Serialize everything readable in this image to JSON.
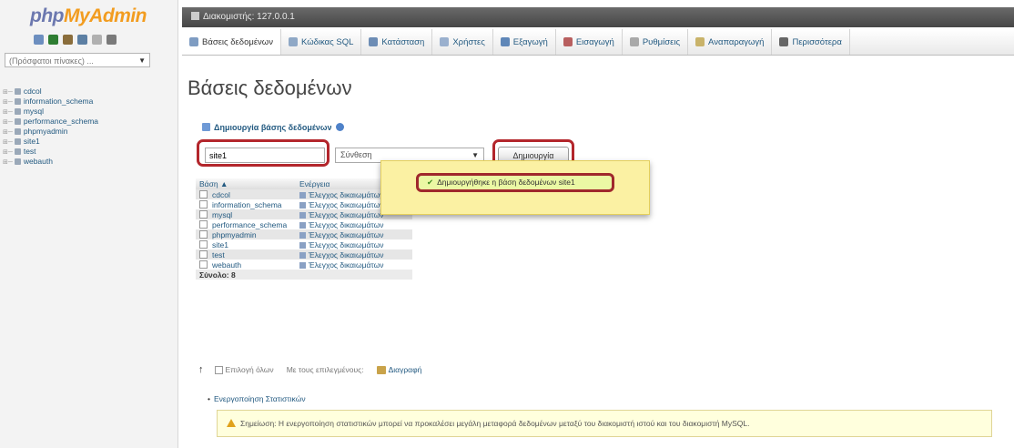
{
  "app": {
    "logo_php": "php",
    "logo_myadmin": "MyAdmin"
  },
  "nav": {
    "recent_placeholder": "(Πρόσφατοι πίνακες) ...",
    "databases": [
      "cdcol",
      "information_schema",
      "mysql",
      "performance_schema",
      "phpmyadmin",
      "site1",
      "test",
      "webauth"
    ],
    "icon_colors": [
      "#6c8ebf",
      "#2e7d32",
      "#8a6d3b",
      "#5c7fa3",
      "#b0b0b0",
      "#7a7a7a"
    ]
  },
  "serverbar": {
    "label": "Διακομιστής: 127.0.0.1"
  },
  "tabs": [
    {
      "label": "Βάσεις δεδομένων",
      "icon": "database-icon",
      "color": "#7e9cc2",
      "active": true
    },
    {
      "label": "Κώδικας SQL",
      "icon": "sql-icon",
      "color": "#8fa8c6",
      "active": false
    },
    {
      "label": "Κατάσταση",
      "icon": "status-icon",
      "color": "#6d8db5",
      "active": false
    },
    {
      "label": "Χρήστες",
      "icon": "users-icon",
      "color": "#9ab0ce",
      "active": false
    },
    {
      "label": "Εξαγωγή",
      "icon": "export-icon",
      "color": "#5f87b8",
      "active": false
    },
    {
      "label": "Εισαγωγή",
      "icon": "import-icon",
      "color": "#b85f5f",
      "active": false
    },
    {
      "label": "Ρυθμίσεις",
      "icon": "settings-icon",
      "color": "#a9a9a9",
      "active": false
    },
    {
      "label": "Αναπαραγωγή",
      "icon": "replication-icon",
      "color": "#c9b36a",
      "active": false
    },
    {
      "label": "Περισσότερα",
      "icon": "chevron-down-icon",
      "color": "#666666",
      "active": false
    }
  ],
  "page": {
    "title": "Βάσεις δεδομένων"
  },
  "create": {
    "header": "Δημιουργία βάσης δεδομένων",
    "db_name_value": "site1",
    "collation_value": "Σύνθεση",
    "button_label": "Δημιουργία",
    "highlight_color": "#b3262c"
  },
  "table": {
    "col_db": "Βάση",
    "col_db_sort": "▲",
    "col_action": "Ενέργεια",
    "privileges_label": "Έλεγχος δικαιωμάτων",
    "rows": [
      "cdcol",
      "information_schema",
      "mysql",
      "performance_schema",
      "phpmyadmin",
      "site1",
      "test",
      "webauth"
    ],
    "total_label": "Σύνολο: 8"
  },
  "success": {
    "message": "Δημιουργήθηκε η βάση δεδομένων site1"
  },
  "bulk": {
    "check_all": "Επιλογή όλων",
    "with_selected": "Με τους επιλεγμένους:",
    "drop": "Διαγραφή"
  },
  "stats": {
    "link": "Ενεργοποίηση Στατιστικών",
    "notice": "Σημείωση: Η ενεργοποίηση στατιστικών μπορεί να προκαλέσει μεγάλη μεταφορά δεδομένων μεταξύ του διακομιστή ιστού και του διακομιστή MySQL."
  }
}
